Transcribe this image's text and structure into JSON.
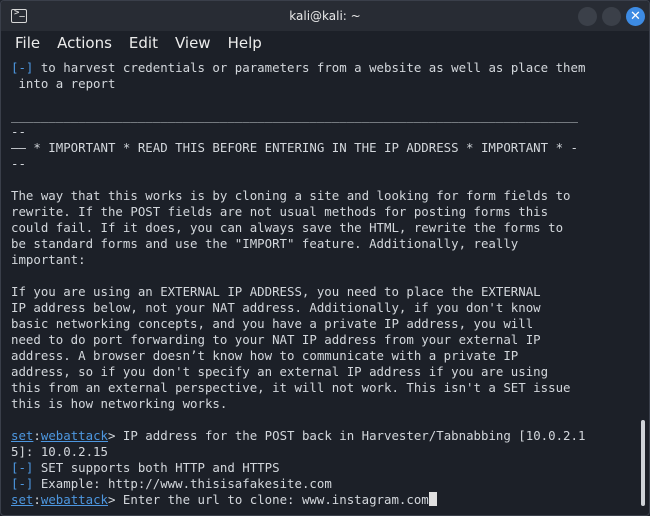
{
  "window": {
    "title": "kali@kali: ~",
    "close_glyph": "✕",
    "terminal_icon": "terminal-app-icon"
  },
  "menu": [
    "File",
    "Actions",
    "Edit",
    "View",
    "Help"
  ],
  "terminal": {
    "lines": [
      [
        {
          "t": "[-]",
          "c": "blue"
        },
        {
          "t": " to harvest credentials or parameters from a website as well as place them"
        }
      ],
      [
        {
          "t": " into a report"
        }
      ],
      [
        {
          "t": ""
        }
      ],
      [
        {
          "t": "____________________________________________________________________________"
        }
      ],
      [
        {
          "t": "--"
        }
      ],
      [
        {
          "t": "—— * IMPORTANT * READ THIS BEFORE ENTERING IN THE IP ADDRESS * IMPORTANT * -"
        }
      ],
      [
        {
          "t": "--"
        }
      ],
      [
        {
          "t": ""
        }
      ],
      [
        {
          "t": "The way that this works is by cloning a site and looking for form fields to"
        }
      ],
      [
        {
          "t": "rewrite. If the POST fields are not usual methods for posting forms this"
        }
      ],
      [
        {
          "t": "could fail. If it does, you can always save the HTML, rewrite the forms to"
        }
      ],
      [
        {
          "t": "be standard forms and use the \"IMPORT\" feature. Additionally, really"
        }
      ],
      [
        {
          "t": "important:"
        }
      ],
      [
        {
          "t": ""
        }
      ],
      [
        {
          "t": "If you are using an EXTERNAL IP ADDRESS, you need to place the EXTERNAL"
        }
      ],
      [
        {
          "t": "IP address below, not your NAT address. Additionally, if you don't know"
        }
      ],
      [
        {
          "t": "basic networking concepts, and you have a private IP address, you will"
        }
      ],
      [
        {
          "t": "need to do port forwarding to your NAT IP address from your external IP"
        }
      ],
      [
        {
          "t": "address. A browser doesn’t know how to communicate with a private IP"
        }
      ],
      [
        {
          "t": "address, so if you don't specify an external IP address if you are using"
        }
      ],
      [
        {
          "t": "this from an external perspective, it will not work. This isn't a SET issue"
        }
      ],
      [
        {
          "t": "this is how networking works."
        }
      ],
      [
        {
          "t": ""
        }
      ],
      [
        {
          "t": "set",
          "c": "blue ul"
        },
        {
          "t": ":"
        },
        {
          "t": "webattack",
          "c": "blue ul"
        },
        {
          "t": "> IP address for the POST back in Harvester/Tabnabbing [10.0.2.1"
        }
      ],
      [
        {
          "t": "5]: 10.0.2.15"
        }
      ],
      [
        {
          "t": "[-]",
          "c": "blue"
        },
        {
          "t": " SET supports both HTTP and HTTPS"
        }
      ],
      [
        {
          "t": "[-]",
          "c": "blue"
        },
        {
          "t": " Example: http://www.thisisafakesite.com"
        }
      ],
      [
        {
          "t": "set",
          "c": "blue ul"
        },
        {
          "t": ":"
        },
        {
          "t": "webattack",
          "c": "blue ul"
        },
        {
          "t": "> Enter the url to clone: www.instagram.com"
        }
      ]
    ]
  }
}
